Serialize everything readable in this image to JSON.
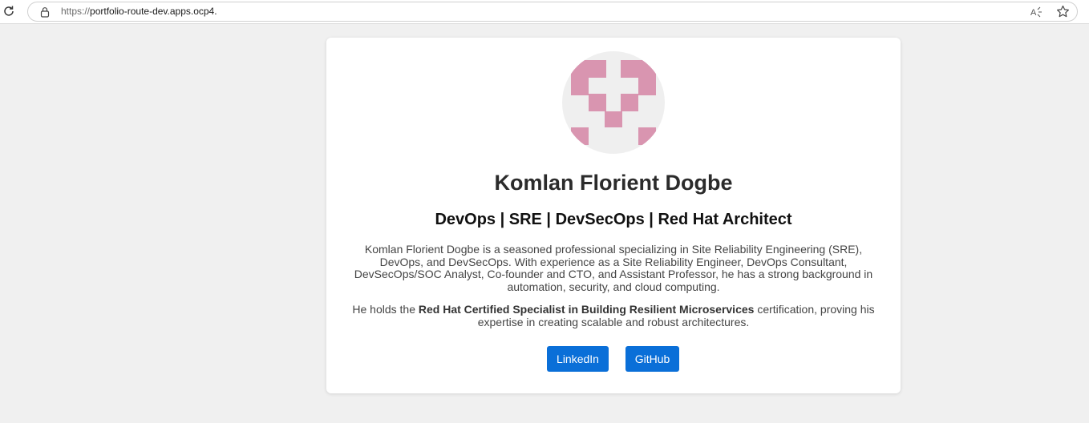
{
  "browser": {
    "url_scheme": "https://",
    "url_rest": "portfolio-route-dev.apps.ocp4.",
    "icons": [
      "reload-icon",
      "lock-icon",
      "read-aloud-icon",
      "favorite-star-icon"
    ]
  },
  "profile": {
    "name": "Komlan Florient Dogbe",
    "headline": "DevOps | SRE | DevSecOps | Red Hat Architect",
    "bio": "Komlan Florient Dogbe is a seasoned professional specializing in Site Reliability Engineering (SRE), DevOps, and DevSecOps. With experience as a Site Reliability Engineer, DevOps Consultant, DevSecOps/SOC Analyst, Co-founder and CTO, and Assistant Professor, he has a strong background in automation, security, and cloud computing.",
    "cert_prefix": "He holds the ",
    "cert_name": "Red Hat Certified Specialist in Building Resilient Microservices",
    "cert_suffix": " certification, proving his expertise in creating scalable and robust architectures."
  },
  "links": {
    "linkedin_label": "LinkedIn",
    "github_label": "GitHub"
  },
  "colors": {
    "button": "#0a6fd8",
    "avatar_pattern": "#d995b0",
    "avatar_bg": "#efefef"
  }
}
